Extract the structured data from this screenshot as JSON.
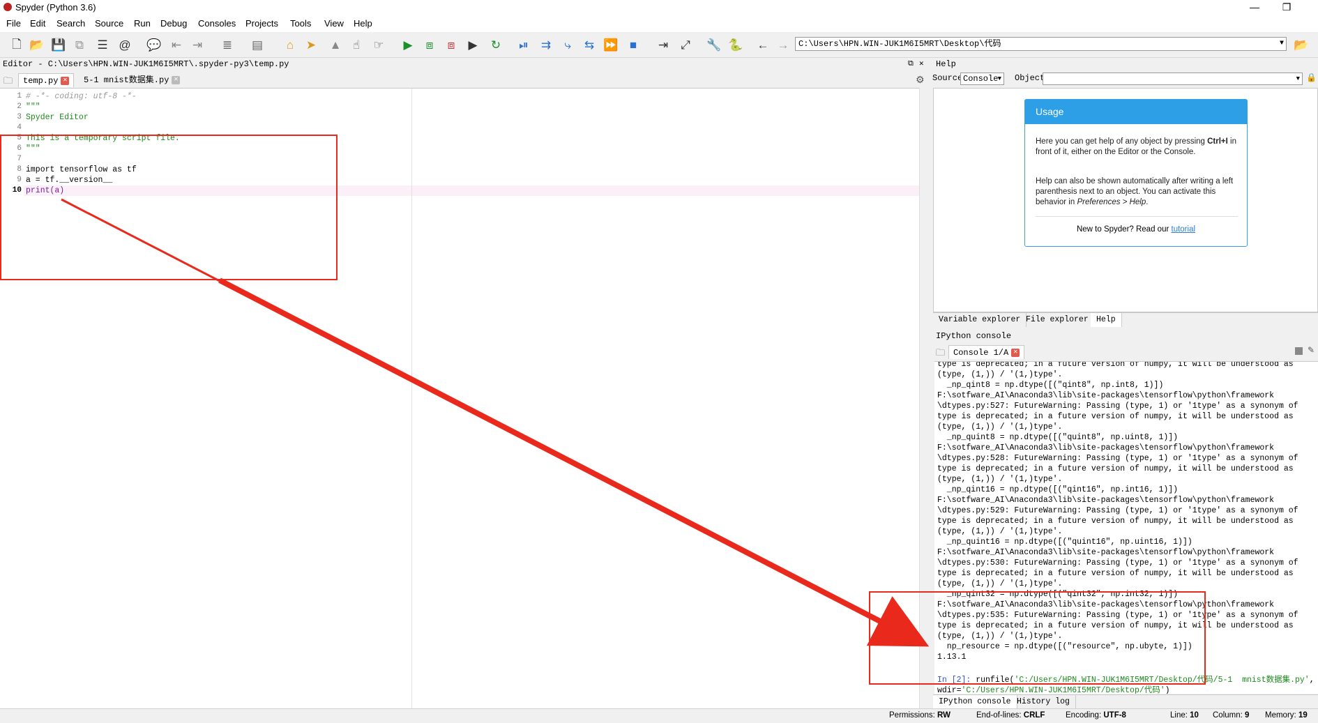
{
  "window": {
    "title": "Spyder (Python 3.6)",
    "minimize": "—",
    "restore": "❐"
  },
  "menu": [
    "File",
    "Edit",
    "Search",
    "Source",
    "Run",
    "Debug",
    "Consoles",
    "Projects",
    "Tools",
    "View",
    "Help"
  ],
  "toolbar": {
    "working_dir": "C:\\Users\\HPN.WIN-JUK1M6I5MRT\\Desktop\\代码"
  },
  "editor": {
    "title": "Editor - C:\\Users\\HPN.WIN-JUK1M6I5MRT\\.spyder-py3\\temp.py",
    "tabs": [
      {
        "label": "temp.py"
      },
      {
        "label": "5-1  mnist数据集.py"
      }
    ],
    "line_numbers": [
      "1",
      "2",
      "3",
      "4",
      "5",
      "6",
      "7",
      "8",
      "9",
      "10"
    ],
    "lines": [
      "# -*- coding: utf-8 -*-",
      "\"\"\"",
      "Spyder Editor",
      "",
      "This is a temporary script file.",
      "\"\"\"",
      "",
      "import tensorflow as tf",
      "a = tf.__version__",
      "print(a)"
    ]
  },
  "help": {
    "title": "Help",
    "source_label": "Source",
    "source_value": "Console",
    "object_label": "Object",
    "usage_title": "Usage",
    "usage_p1a": "Here you can get help of any object by pressing ",
    "usage_p1b": "Ctrl+I",
    "usage_p1c": " in front of it, either on the Editor or the Console.",
    "usage_p2a": "Help can also be shown automatically after writing a left parenthesis next to an object. You can activate this behavior in ",
    "usage_p2b": "Preferences > Help",
    "usage_p2c": ".",
    "new_text": "New to Spyder? Read our ",
    "tutorial_link": "tutorial"
  },
  "right_tabs_top": [
    "Variable explorer",
    "File explorer",
    "Help"
  ],
  "console": {
    "title": "IPython console",
    "tab": "Console 1/A",
    "lines": [
      "type is deprecated; in a future version of numpy, it will be understood as",
      "(type, (1,)) / '(1,)type'.",
      "  _np_qint8 = np.dtype([(\"qint8\", np.int8, 1)])",
      "F:\\sotfware_AI\\Anaconda3\\lib\\site-packages\\tensorflow\\python\\framework",
      "\\dtypes.py:527: FutureWarning: Passing (type, 1) or '1type' as a synonym of",
      "type is deprecated; in a future version of numpy, it will be understood as",
      "(type, (1,)) / '(1,)type'.",
      "  _np_quint8 = np.dtype([(\"quint8\", np.uint8, 1)])",
      "F:\\sotfware_AI\\Anaconda3\\lib\\site-packages\\tensorflow\\python\\framework",
      "\\dtypes.py:528: FutureWarning: Passing (type, 1) or '1type' as a synonym of",
      "type is deprecated; in a future version of numpy, it will be understood as",
      "(type, (1,)) / '(1,)type'.",
      "  _np_qint16 = np.dtype([(\"qint16\", np.int16, 1)])",
      "F:\\sotfware_AI\\Anaconda3\\lib\\site-packages\\tensorflow\\python\\framework",
      "\\dtypes.py:529: FutureWarning: Passing (type, 1) or '1type' as a synonym of",
      "type is deprecated; in a future version of numpy, it will be understood as",
      "(type, (1,)) / '(1,)type'.",
      "  _np_quint16 = np.dtype([(\"quint16\", np.uint16, 1)])",
      "F:\\sotfware_AI\\Anaconda3\\lib\\site-packages\\tensorflow\\python\\framework",
      "\\dtypes.py:530: FutureWarning: Passing (type, 1) or '1type' as a synonym of",
      "type is deprecated; in a future version of numpy, it will be understood as",
      "(type, (1,)) / '(1,)type'.",
      "  _np_qint32 = np.dtype([(\"qint32\", np.int32, 1)])",
      "F:\\sotfware_AI\\Anaconda3\\lib\\site-packages\\tensorflow\\python\\framework",
      "\\dtypes.py:535: FutureWarning: Passing (type, 1) or '1type' as a synonym of",
      "type is deprecated; in a future version of numpy, it will be understood as",
      "(type, (1,)) / '(1,)type'.",
      "  np_resource = np.dtype([(\"resource\", np.ubyte, 1)])",
      "1.13.1",
      ""
    ],
    "prompt": "In [2]: ",
    "run_cmd_a": "runfile(",
    "run_cmd_b": "'C:/Users/HPN.WIN-JUK1M6I5MRT/Desktop/代码/5-1  mnist数据集.py'",
    "run_cmd_c": ",",
    "wdir_a": "wdir=",
    "wdir_b": "'C:/Users/HPN.WIN-JUK1M6I5MRT/Desktop/代码'",
    "wdir_c": ")"
  },
  "right_tabs_bottom": [
    "IPython console",
    "History log"
  ],
  "status": {
    "perm_label": "Permissions:",
    "perm_value": "RW",
    "eol_label": "End-of-lines:",
    "eol_value": "CRLF",
    "enc_label": "Encoding:",
    "enc_value": "UTF-8",
    "line_label": "Line:",
    "line_value": "10",
    "col_label": "Column:",
    "col_value": "9",
    "mem_label": "Memory:",
    "mem_value": "19"
  },
  "colors": {
    "annotation": "#e8291c",
    "usage_header": "#2d9fe6",
    "string_green": "#1d8a1d",
    "keyword_blue": "#2a56c6"
  }
}
